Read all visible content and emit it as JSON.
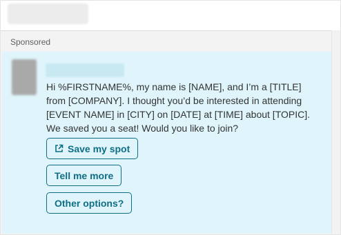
{
  "header": {
    "sponsored_label": "Sponsored"
  },
  "message": {
    "body": "Hi %FIRSTNAME%, my name is [NAME], and I’m a [TITLE] from [COMPANY]. I thought you’d be interested in attending [EVENT NAME] in [CITY] on [DATE] at [TIME] about [TOPIC]. We saved you a seat! Would you like to join?"
  },
  "buttons": [
    {
      "label": "Save my spot",
      "icon": "external-link-icon"
    },
    {
      "label": "Tell me more"
    },
    {
      "label": "Other options?"
    }
  ],
  "colors": {
    "accent": "#0e6e86",
    "message_bg": "#dff5fb"
  }
}
